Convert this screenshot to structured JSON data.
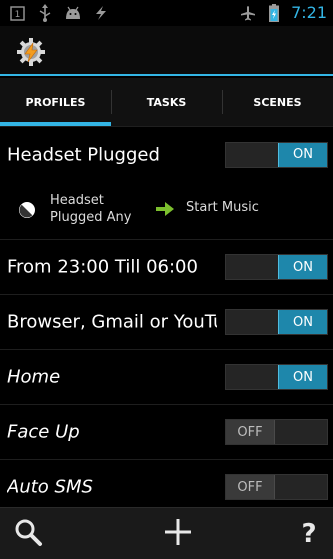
{
  "status_bar": {
    "time": "7:21",
    "left_icons": [
      "notification-box-icon",
      "usb-icon",
      "android-icon",
      "lightning-icon"
    ],
    "right_icons": [
      "airplane-mode-icon",
      "battery-charging-icon"
    ],
    "notification_count": "1"
  },
  "action_bar": {
    "app_icon": "tasker-gear-bolt-icon",
    "accent_color": "#33b5e5"
  },
  "tabs": [
    {
      "label": "PROFILES",
      "active": true
    },
    {
      "label": "TASKS",
      "active": false
    },
    {
      "label": "SCENES",
      "active": false
    }
  ],
  "profiles": [
    {
      "title": "Headset Plugged",
      "state": "ON",
      "italic": false
    },
    {
      "title": "From 23:00 Till 06:00",
      "state": "ON",
      "italic": false
    },
    {
      "title": "Browser, Gmail or YouTube",
      "state": "ON",
      "italic": false
    },
    {
      "title": "Home",
      "state": "ON",
      "italic": true
    },
    {
      "title": "Face Up",
      "state": "OFF",
      "italic": true
    },
    {
      "title": "Auto SMS",
      "state": "OFF",
      "italic": true
    }
  ],
  "expanded_profile": {
    "context_icon": "half-circle-context-icon",
    "context_line1": "Headset",
    "context_line2": "Plugged Any",
    "task_icon": "green-arrow-icon",
    "task_label": "Start Music"
  },
  "bottom_bar": {
    "search_icon": "search-icon",
    "add_icon": "plus-icon",
    "help_label": "?"
  },
  "colors": {
    "accent": "#33b5e5",
    "toggle_on": "#1e87ab",
    "arrow_green": "#7cbf2e"
  }
}
